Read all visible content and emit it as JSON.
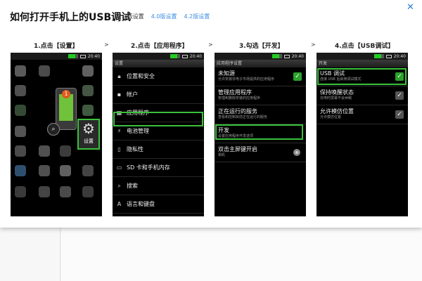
{
  "title": "如何打开手机上的USB调试",
  "version_tabs": [
    "2.3版设置",
    "4.0版设置",
    "4.2版设置"
  ],
  "close_glyph": "✕",
  "arrow_glyph": ">",
  "steps": [
    {
      "label": "1.点击【设置】"
    },
    {
      "label": "2.点击【应用程序】"
    },
    {
      "label": "3.勾选【开发】"
    },
    {
      "label": "4.点击【USB调试】"
    }
  ],
  "status_time": "20:40",
  "phone1": {
    "settings_label": "设置",
    "badge": "1",
    "gear_icon": "gear-icon"
  },
  "phone2": {
    "titlebar": "设置",
    "items": [
      {
        "label": "位置和安全",
        "icon": "lock-icon"
      },
      {
        "label": "帐户",
        "icon": "account-icon"
      },
      {
        "label": "应用程序",
        "icon": "apps-icon"
      },
      {
        "label": "电池管理",
        "icon": "battery-icon"
      },
      {
        "label": "隐私性",
        "icon": "privacy-icon"
      },
      {
        "label": "SD 卡和手机内存",
        "icon": "sd-card-icon"
      },
      {
        "label": "搜索",
        "icon": "search-icon"
      },
      {
        "label": "语言和键盘",
        "icon": "keyboard-icon"
      }
    ]
  },
  "phone3": {
    "titlebar": "应用程序设置",
    "items": [
      {
        "title": "未知源",
        "sub": "允许安装非电子市场提供的应用程序",
        "control": "check"
      },
      {
        "title": "管理应用程序",
        "sub": "管理和删除安装的应用程序",
        "control": ""
      },
      {
        "title": "正在运行的服务",
        "sub": "查看和控制目前正在运行的服务",
        "control": ""
      },
      {
        "title": "开发",
        "sub": "设置应用程序开发选项",
        "control": ""
      },
      {
        "title": "双击主屏键开启",
        "sub": "相机",
        "control": "radio"
      }
    ]
  },
  "phone4": {
    "titlebar": "开发",
    "items": [
      {
        "title": "USB 调试",
        "sub": "连接 USB 后启用调试模式",
        "checked": true
      },
      {
        "title": "保持唤醒状态",
        "sub": "充电时屏幕不会休眠",
        "checked": false
      },
      {
        "title": "允许模仿位置",
        "sub": "允许模仿位置",
        "checked": false
      }
    ]
  },
  "colors": {
    "highlight": "#39c23b",
    "link": "#3a8ce0",
    "close": "#2a7fd4"
  }
}
